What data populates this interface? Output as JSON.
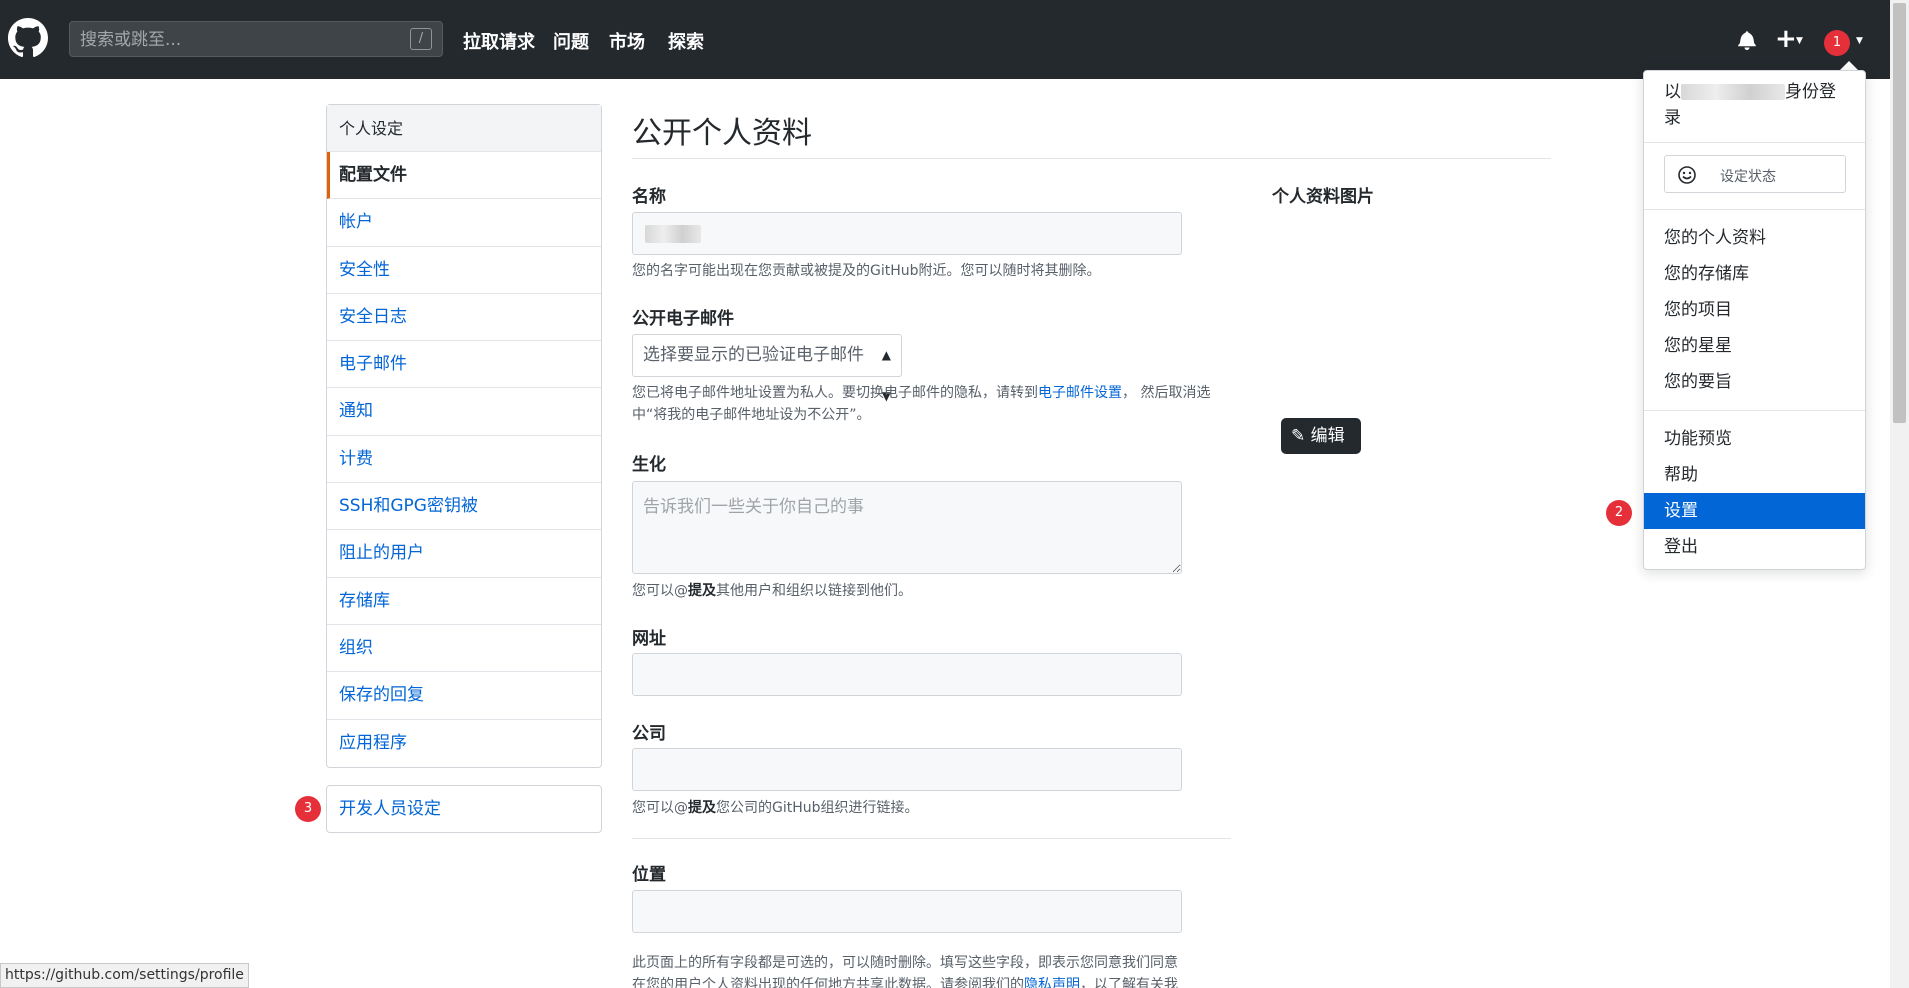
{
  "header": {
    "search_placeholder": "搜索或跳至...",
    "search_shortcut": "/",
    "nav": [
      "拉取请求",
      "问题",
      "市场",
      "探索"
    ],
    "badge_avatar": "1"
  },
  "sidebar": {
    "heading": "个人设定",
    "items": [
      "配置文件",
      "帐户",
      "安全性",
      "安全日志",
      "电子邮件",
      "通知",
      "计费",
      "SSH和GPG密钥被",
      "阻止的用户",
      "存储库",
      "组织",
      "保存的回复",
      "应用程序"
    ],
    "active_index": 0,
    "developer_settings": "开发人员设定",
    "badge_dev": "3"
  },
  "main": {
    "title": "公开个人资料",
    "name_label": "名称",
    "name_note": "您的名字可能出现在您贡献或被提及的GitHub附近。您可以随时将其删除。",
    "email_label": "公开电子邮件",
    "email_select": "选择要显示的已验证电子邮件",
    "email_note_1": "您已将电子邮件地址设置为私人。要切换电子邮件的隐私，请转到",
    "email_note_link": "电子邮件设置",
    "email_note_2": "， 然后取消选中“将我的电子邮件地址设为不公开”。",
    "bio_label": "生化",
    "bio_placeholder": "告诉我们一些关于你自己的事",
    "bio_note_1": "您可以@",
    "bio_note_bold": "提及",
    "bio_note_2": "其他用户和组织以链接到他们。",
    "url_label": "网址",
    "company_label": "公司",
    "company_note_1": "您可以@",
    "company_note_bold": "提及",
    "company_note_2": "您公司的GitHub组织进行链接。",
    "location_label": "位置",
    "footer_note_1": "此页面上的所有字段都是可选的，可以随时删除。填写这些字段，即表示您同意我们同意",
    "footer_note_2": "在您的用户个人资料出现的任何地方共享此数据。请参阅我们的",
    "footer_note_link": "隐私声明",
    "footer_note_3": "，以了解有关我",
    "picture_label": "个人资料图片",
    "edit_button": "编辑"
  },
  "dropdown": {
    "signed_in_prefix": "以",
    "signed_in_suffix": "身份登",
    "signed_in_line2": "录",
    "set_status": "设定状态",
    "group1": [
      "您的个人资料",
      "您的存储库",
      "您的项目",
      "您的星星",
      "您的要旨"
    ],
    "group2": [
      "功能预览",
      "帮助",
      "设置",
      "登出"
    ],
    "selected": "设置",
    "badge_settings": "2"
  },
  "statusbar_url": "https://github.com/settings/profile",
  "colors": {
    "header_bg": "#24292e",
    "link": "#0366d6",
    "active_border": "#e36209",
    "badge": "#e5303a",
    "selected_item": "#0366d6"
  }
}
